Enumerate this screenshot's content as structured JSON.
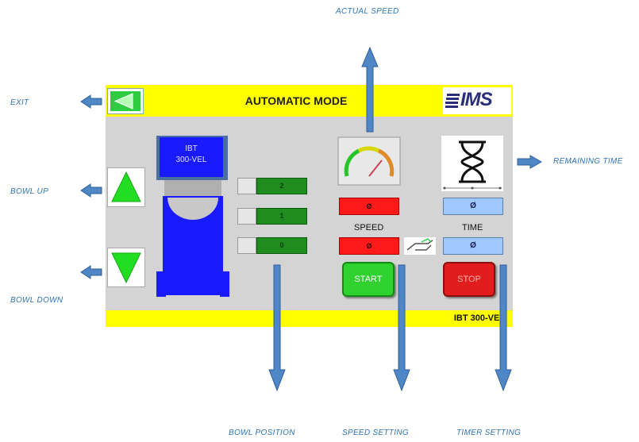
{
  "callouts": {
    "actual_speed": "ACTUAL SPEED",
    "exit": "EXIT",
    "bowl_up": "BOWL UP",
    "bowl_down": "BOWL DOWN",
    "remaining_time": "REMAINING TIME",
    "bowl_position": "BOWL POSITION",
    "speed_setting": "SPEED SETTING",
    "timer_setting": "TIMER SETTING"
  },
  "header": {
    "title": "AUTOMATIC MODE",
    "logo": "IMS"
  },
  "bowl": {
    "label_line1": "IBT",
    "label_line2": "300-VEL"
  },
  "positions": [
    "2",
    "1",
    "0"
  ],
  "speed": {
    "actual_value": "Ø",
    "label": "SPEED",
    "setting_value": "Ø"
  },
  "time": {
    "remaining_value": "Ø",
    "label": "TIME",
    "setting_value": "Ø"
  },
  "buttons": {
    "start": "START",
    "stop": "STOP"
  },
  "footer": {
    "model": "IBT 300-VEL"
  },
  "colors": {
    "header_bar": "#ffff00",
    "panel": "#d4d4d4",
    "accent_arrow": "#4f86c6",
    "start": "#2ed12e",
    "stop": "#e11d1d",
    "bowl": "#1a1aff"
  }
}
